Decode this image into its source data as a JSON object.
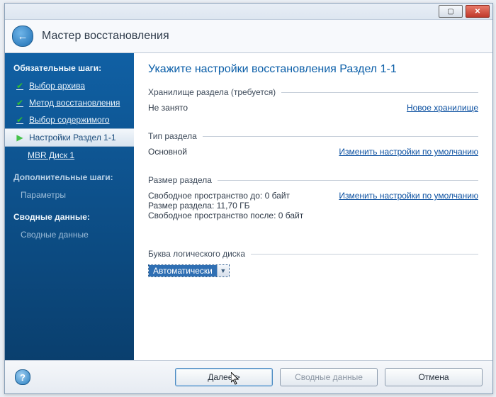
{
  "window": {
    "title": "Мастер восстановления"
  },
  "sidebar": {
    "required_heading": "Обязательные шаги:",
    "optional_heading": "Дополнительные шаги:",
    "summary_heading": "Сводные данные:",
    "items": {
      "archive": "Выбор архива",
      "method": "Метод восстановления",
      "contents": "Выбор содержимого",
      "current": "Настройки Раздел 1-1",
      "mbr": "MBR Диск 1",
      "params": "Параметры",
      "summary": "Сводные данные"
    }
  },
  "main": {
    "heading": "Укажите настройки восстановления Раздел 1-1",
    "storage": {
      "label": "Хранилище раздела (требуется)",
      "value": "Не занято",
      "link": "Новое хранилище"
    },
    "ptype": {
      "label": "Тип раздела",
      "value": "Основной",
      "link": "Изменить настройки по умолчанию"
    },
    "psize": {
      "label": "Размер раздела",
      "before": "Свободное пространство до: 0 байт",
      "size": "Размер раздела: 11,70 ГБ",
      "after": "Свободное пространство после: 0 байт",
      "link": "Изменить настройки по умолчанию"
    },
    "letter": {
      "label": "Буква логического диска",
      "value": "Автоматически"
    }
  },
  "footer": {
    "next": "Далее >",
    "summary": "Сводные данные",
    "cancel": "Отмена"
  }
}
